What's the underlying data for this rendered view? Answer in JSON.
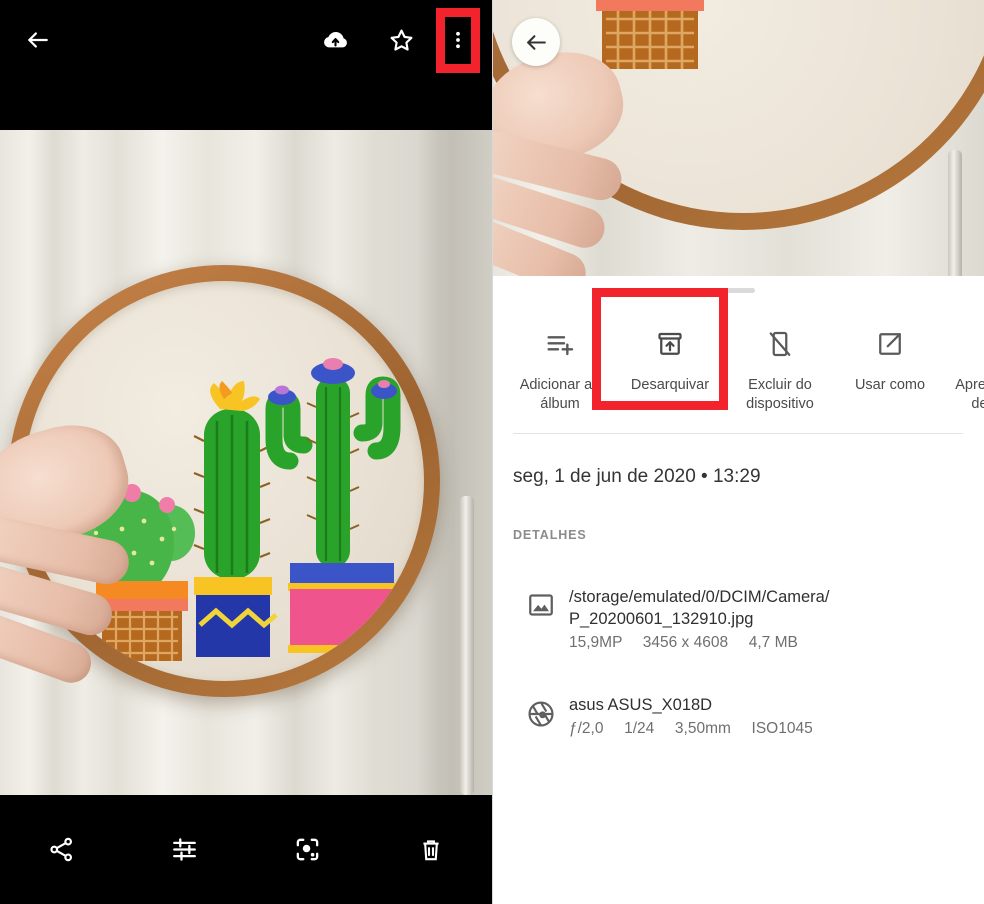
{
  "colors": {
    "highlight": "#f3232d",
    "sheet_bg": "#ffffff",
    "toolbar_bg": "#000000",
    "accent_text": "#4a4a4a"
  },
  "left_panel": {
    "top_toolbar": {
      "back": {
        "icon": "arrow-back-icon",
        "label": "Voltar"
      },
      "backup": {
        "icon": "cloud-upload-icon",
        "label": "Fazer backup"
      },
      "favorite": {
        "icon": "star-outline-icon",
        "label": "Favoritar"
      },
      "overflow": {
        "icon": "more-vert-icon",
        "label": "Mais opções",
        "highlighted": true
      }
    },
    "photo": {
      "alt": "Bastidor de bordado com cactos",
      "hoop_color": "#b4743a",
      "fabric_color": "#ece5d8"
    },
    "bottom_toolbar": [
      {
        "icon": "share-icon",
        "label": "Compartilhar"
      },
      {
        "icon": "tune-icon",
        "label": "Editar"
      },
      {
        "icon": "lens-icon",
        "label": "Google Lens"
      },
      {
        "icon": "trash-icon",
        "label": "Excluir"
      }
    ]
  },
  "right_panel": {
    "back": {
      "icon": "arrow-back-icon",
      "label": "Voltar"
    },
    "sheet": {
      "drag_handle": "drag-handle",
      "actions": [
        {
          "icon": "playlist-add-icon",
          "label": "Adicionar ao álbum",
          "highlighted": false
        },
        {
          "icon": "unarchive-icon",
          "label": "Desarquivar",
          "highlighted": true
        },
        {
          "icon": "phone-off-icon",
          "label": "Excluir do dispositivo",
          "highlighted": false
        },
        {
          "icon": "open-in-new-icon",
          "label": "Usar como",
          "highlighted": false
        },
        {
          "icon": "slideshow-icon",
          "label": "Apresentação de slides",
          "highlighted": false
        }
      ],
      "date": "seg, 1 de jun de 2020  •  13:29",
      "details_header": "DETALHES",
      "details": [
        {
          "icon": "image-icon",
          "primary_line1": "/storage/emulated/0/DCIM/Camera/",
          "primary_line2": "P_20200601_132910.jpg",
          "megapixels": "15,9MP",
          "dimensions": "3456 x 4608",
          "filesize": "4,7 MB"
        },
        {
          "icon": "aperture-icon",
          "primary": "asus ASUS_X018D",
          "aperture": "ƒ/2,0",
          "shutter": "1/24",
          "focal": "3,50mm",
          "iso": "ISO1045"
        }
      ]
    }
  }
}
